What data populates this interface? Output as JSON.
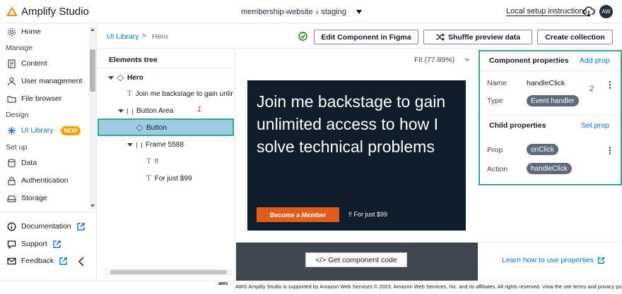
{
  "app": {
    "title": "Amplify Studio"
  },
  "topbar": {
    "project": "membership-website",
    "environment": "staging",
    "local_setup": "Local setup instructions",
    "avatar_initials": "AW"
  },
  "sidebar": {
    "home": "Home",
    "manage_header": "Manage",
    "content": "Content",
    "user_management": "User management",
    "file_browser": "File browser",
    "design_header": "Design",
    "ui_library": "UI Library",
    "new_badge": "NEW",
    "setup_header": "Set up",
    "data": "Data",
    "authentication": "Authentication",
    "storage": "Storage",
    "documentation": "Documentation",
    "support": "Support",
    "feedback": "Feedback"
  },
  "breadcrumb": {
    "root": "UI Library",
    "separator": ">",
    "current": "Hero"
  },
  "toolbar": {
    "edit_figma": "Edit Component in Figma",
    "shuffle": "Shuffle preview data",
    "create_collection": "Create collection"
  },
  "tree": {
    "title": "Elements tree",
    "nodes": [
      {
        "label": "Hero"
      },
      {
        "label": "Join me backstage to gain unlim"
      },
      {
        "label": "Button Area"
      },
      {
        "label": "Button"
      },
      {
        "label": "Frame 5588"
      },
      {
        "label": "!!"
      },
      {
        "label": "For just $99"
      }
    ]
  },
  "preview": {
    "zoom": "Fit (77.89%)",
    "heading": "Join me backstage to gain unlimited access to how I solve technical problems",
    "button": "Become a Member",
    "price": "!! For just $99",
    "get_code": "</> Get component code"
  },
  "properties": {
    "component_title": "Component properties",
    "add_prop": "Add prop",
    "name_label": "Name",
    "name_value": "handleClick",
    "type_label": "Type",
    "type_value": "Event handler",
    "child_title": "Child properties",
    "set_prop": "Set prop",
    "prop_label": "Prop",
    "prop_value": "onClick",
    "action_label": "Action",
    "action_value": "handleClick",
    "learn": "Learn how to use properties"
  },
  "markers": {
    "one": "1",
    "two": "2"
  },
  "footer": {
    "aws": "aws",
    "text": "AWS Amplify Studio is supported by Amazon Web Services © 2023, Amazon Web Services, Inc. and its affiliates. All rights reserved. View the site terms and privacy policy."
  },
  "colors": {
    "accent": "#0972d3",
    "badge": "#f0a300",
    "hero_bg": "#0f1c2a",
    "cta": "#e05d1c",
    "highlight": "#3aa58f"
  }
}
